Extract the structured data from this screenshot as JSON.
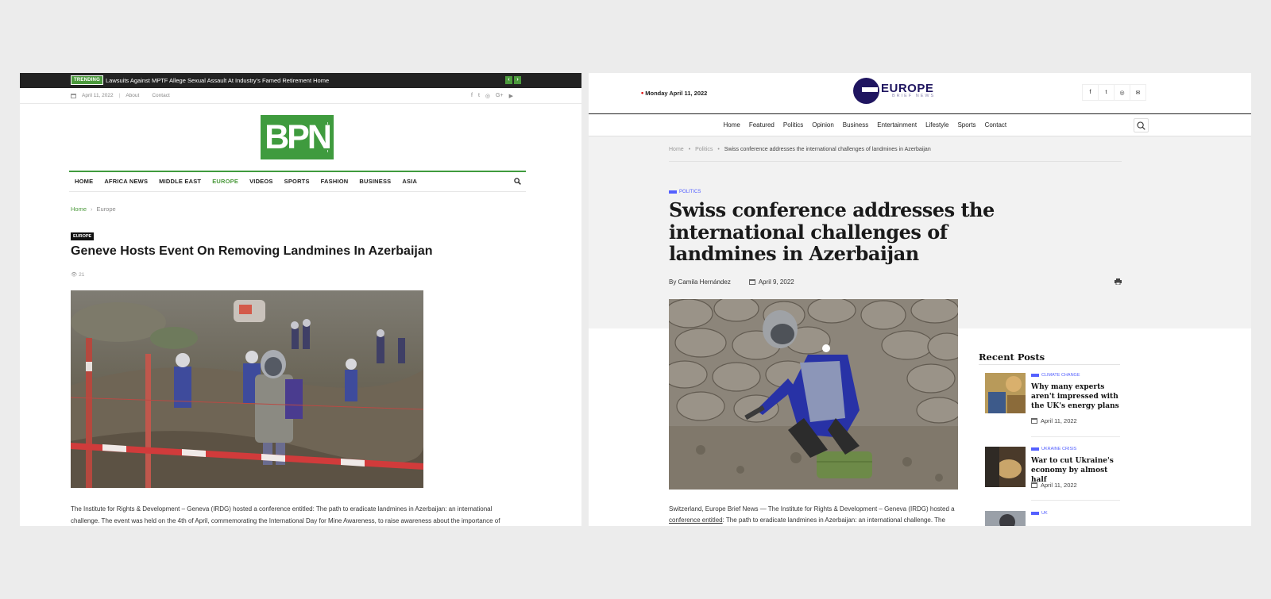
{
  "left": {
    "trending": {
      "badge": "TRENDING",
      "text": "Lawsuits Against MPTF Allege Sexual Assault At Industry's Famed Retirement Home",
      "prev": "‹",
      "next": "›"
    },
    "topbar": {
      "date": "April 11, 2022",
      "about": "About",
      "contact": "Contact",
      "social": [
        "f",
        "t",
        "◎",
        "G+",
        "▶"
      ]
    },
    "logo_text": "BPN",
    "nav": [
      "HOME",
      "AFRICA NEWS",
      "MIDDLE EAST",
      "EUROPE",
      "VIDEOS",
      "SPORTS",
      "FASHION",
      "BUSINESS",
      "ASIA"
    ],
    "nav_active": "EUROPE",
    "breadcrumb": {
      "home": "Home",
      "sep": "›",
      "current": "Europe"
    },
    "category": "EUROPE",
    "headline": "Geneve Hosts Event On Removing Landmines In Azerbaijan",
    "views": "21",
    "body": "The Institute for Rights & Development – Geneva (IRDG) hosted a conference entitled: The path to eradicate landmines in Azerbaijan: an international challenge. The event was held on the 4th of April, commemorating the International Day for Mine Awareness, to raise awareness about the importance of"
  },
  "right": {
    "date": "Monday April 11, 2022",
    "logo": {
      "big": "EUROPE",
      "small": "BRIEF NEWS"
    },
    "social": [
      "f",
      "t",
      "◎",
      "✉"
    ],
    "nav": [
      "Home",
      "Featured",
      "Politics",
      "Opinion",
      "Business",
      "Entertainment",
      "Lifestyle",
      "Sports",
      "Contact"
    ],
    "breadcrumb": {
      "home": "Home",
      "section": "Politics",
      "current": "Swiss conference addresses the international challenges of landmines in Azerbaijan"
    },
    "category": "POLITICS",
    "title": "Swiss conference addresses the international challenges of landmines in Azerbaijan",
    "author": "By Camila Hernández",
    "date_posted": "April 9, 2022",
    "body_start": "Switzerland, Europe Brief News — The Institute for Rights & Development – Geneva (IRDG) hosted a ",
    "body_link": "conference entitled",
    "body_end": ": The path to eradicate landmines in Azerbaijan: an international challenge. The",
    "recent_posts_heading": "Recent Posts",
    "recent_posts": [
      {
        "category": "CLIMATE CHANGE",
        "title": "Why many experts aren't impressed with the UK's energy plans",
        "date": "April 11, 2022"
      },
      {
        "category": "UKRAINE CRISIS",
        "title": "War to cut Ukraine's economy by almost half",
        "date": "April 11, 2022"
      },
      {
        "category": "UK",
        "title": "",
        "date": ""
      }
    ]
  },
  "colors": {
    "bpn_green": "#3f9b3e",
    "europe_navy": "#1f1560",
    "category_blue": "#5460ff"
  }
}
